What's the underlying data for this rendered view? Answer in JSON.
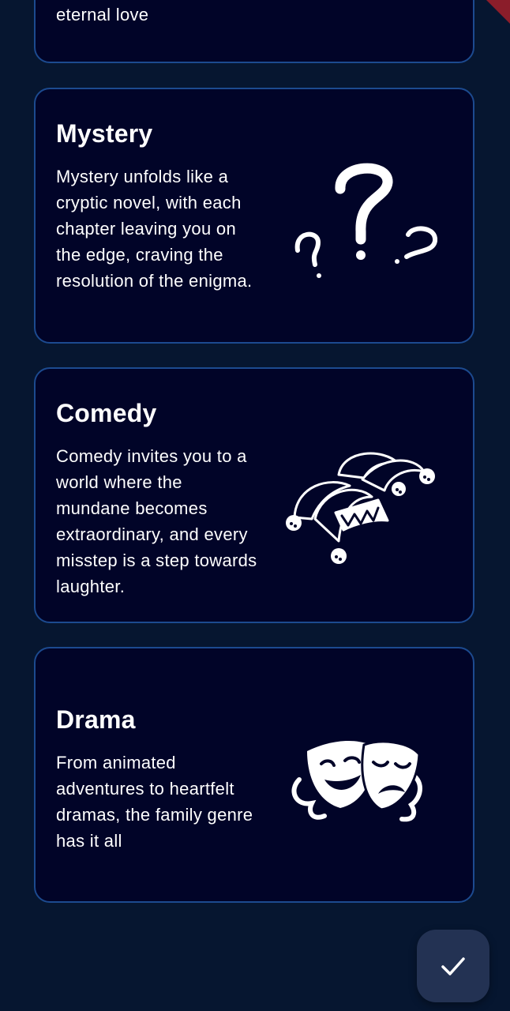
{
  "cards": [
    {
      "title": "",
      "description": "eternal love",
      "icon": "heart-icon"
    },
    {
      "title": "Mystery",
      "description": "Mystery unfolds like a cryptic novel, with each chapter leaving you on the edge, craving the resolution of the enigma.",
      "icon": "question-marks-icon"
    },
    {
      "title": "Comedy",
      "description": "Comedy invites you to a world where the mundane becomes extraordinary, and every misstep is a step towards laughter.",
      "icon": "jester-hat-icon"
    },
    {
      "title": "Drama",
      "description": "From animated adventures to heartfelt dramas, the family genre has it all",
      "icon": "theater-masks-icon"
    }
  ],
  "fab": {
    "icon": "checkmark-icon"
  },
  "colors": {
    "background": "#061630",
    "card_background": "#010428",
    "card_border": "#1c4a8f",
    "fab_background": "#233253",
    "text": "#ffffff"
  }
}
